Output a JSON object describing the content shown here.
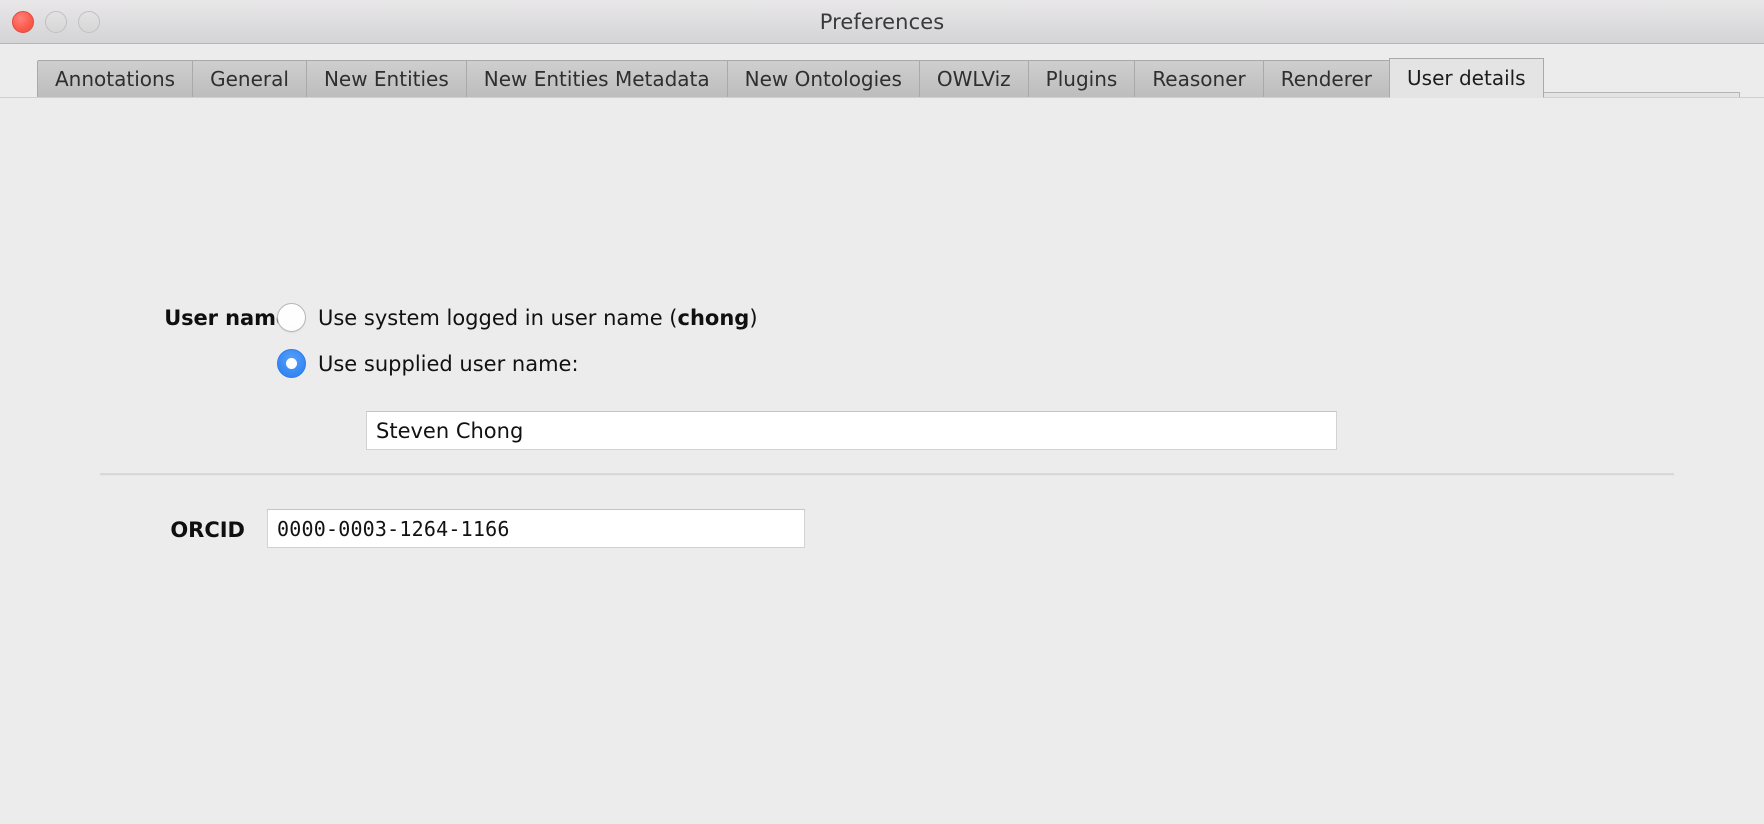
{
  "window": {
    "title": "Preferences",
    "traffic_lights": [
      {
        "name": "close",
        "color": "#fc5c50"
      },
      {
        "name": "minimize",
        "color": "#d6d6d6"
      },
      {
        "name": "maximize",
        "color": "#d6d6d6"
      }
    ]
  },
  "tabs": [
    {
      "label": "Annotations",
      "selected": false
    },
    {
      "label": "General",
      "selected": false
    },
    {
      "label": "New Entities",
      "selected": false
    },
    {
      "label": "New Entities Metadata",
      "selected": false
    },
    {
      "label": "New Ontologies",
      "selected": false
    },
    {
      "label": "OWLViz",
      "selected": false
    },
    {
      "label": "Plugins",
      "selected": false
    },
    {
      "label": "Reasoner",
      "selected": false
    },
    {
      "label": "Renderer",
      "selected": false
    },
    {
      "label": "User details",
      "selected": true
    }
  ],
  "user_details": {
    "username_label": "User name",
    "option_system": {
      "text_before": "Use system logged in user name (",
      "system_user": "chong",
      "text_after": ")",
      "selected": false
    },
    "option_supplied": {
      "label": "Use supplied user name:",
      "selected": true
    },
    "username_field": {
      "value": "Steven Chong",
      "placeholder": ""
    },
    "orcid_label": "ORCID",
    "orcid_field": {
      "value": "0000-0003-1264-1166",
      "placeholder": ""
    }
  },
  "colors": {
    "window_bg": "#ececec",
    "titlebar_bg": "#dedddf",
    "tab_bg": "#c6c6c6",
    "tab_selected_bg": "#e4e4e4",
    "radio_accent": "#3b8cf5",
    "field_bg": "#ffffff",
    "text": "#111111"
  }
}
